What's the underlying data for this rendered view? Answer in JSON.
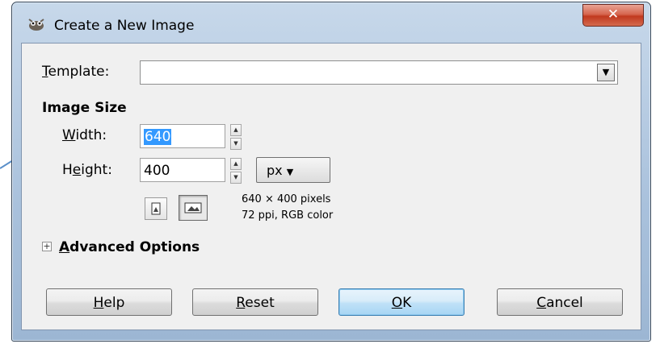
{
  "window": {
    "title": "Create a New Image",
    "close_glyph": "✕"
  },
  "template": {
    "label_prefix": "",
    "label_mnemonic": "T",
    "label_rest": "emplate:",
    "value": ""
  },
  "image_size": {
    "section_label": "Image Size",
    "width": {
      "label_prefix": "",
      "label_mnemonic": "W",
      "label_rest": "idth:",
      "value": "640"
    },
    "height": {
      "label_prefix": "H",
      "label_mnemonic": "e",
      "label_rest": "ight:",
      "value": "400"
    },
    "unit": "px",
    "info_line1": "640 × 400 pixels",
    "info_line2": "72 ppi, RGB color"
  },
  "advanced": {
    "expander_glyph": "+",
    "label_mnemonic": "A",
    "label_rest": "dvanced Options"
  },
  "buttons": {
    "help": {
      "mnemonic": "H",
      "rest": "elp"
    },
    "reset": {
      "mnemonic": "R",
      "rest": "eset"
    },
    "ok": {
      "mnemonic": "O",
      "rest": "K"
    },
    "cancel": {
      "mnemonic": "C",
      "rest": "ancel"
    }
  },
  "colors": {
    "selection": "#3399ff",
    "default_button": "#bfe1f7",
    "close_button": "#c1391f"
  }
}
